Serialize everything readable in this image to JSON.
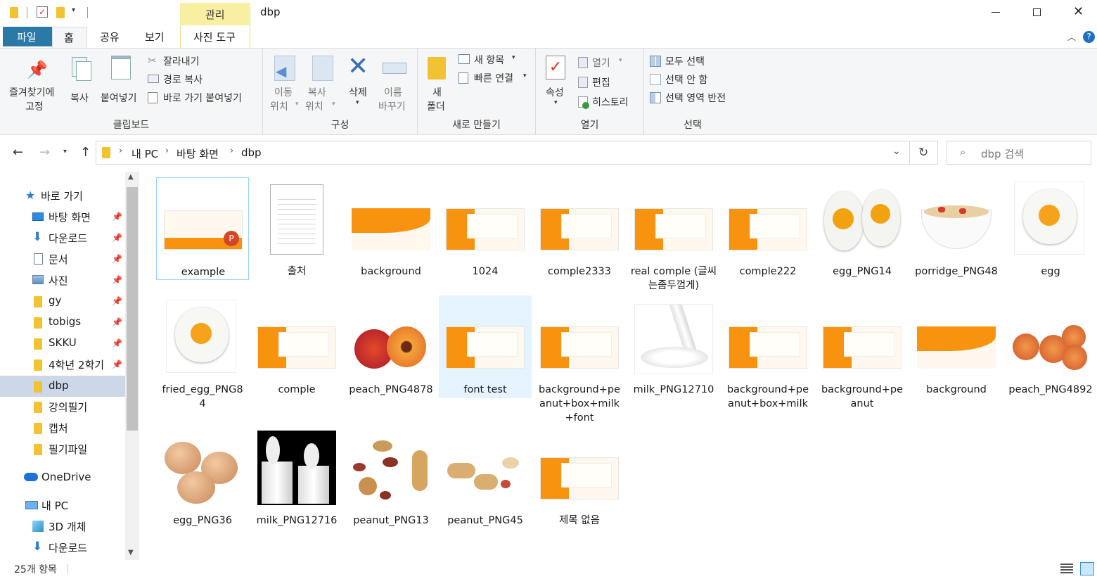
{
  "window": {
    "title": "dbp",
    "context_tab": "관리",
    "minimize_icon": "minimize-icon",
    "maximize_icon": "maximize-icon",
    "close_icon": "close-icon"
  },
  "ribbon_tabs": {
    "file": "파일",
    "home": "홈",
    "share": "공유",
    "view": "보기",
    "picture_tools": "사진 도구"
  },
  "clipboard": {
    "pin_line1": "즐겨찾기에",
    "pin_line2": "고정",
    "copy": "복사",
    "paste": "붙여넣기",
    "cut": "잘라내기",
    "copy_path": "경로 복사",
    "paste_shortcut": "바로 가기 붙여넣기",
    "group": "클립보드"
  },
  "organize": {
    "move_to_1": "이동",
    "move_to_2": "위치",
    "copy_to_1": "복사",
    "copy_to_2": "위치",
    "delete": "삭제",
    "rename_1": "이름",
    "rename_2": "바꾸기",
    "group": "구성"
  },
  "new": {
    "new_folder_1": "새",
    "new_folder_2": "폴더",
    "new_item": "새 항목",
    "easy_access": "빠른 연결",
    "group": "새로 만들기"
  },
  "open": {
    "properties": "속성",
    "open": "열기",
    "edit": "편집",
    "history": "히스토리",
    "group": "열기"
  },
  "select": {
    "select_all": "모두 선택",
    "select_none": "선택 안 함",
    "invert": "선택 영역 반전",
    "group": "선택"
  },
  "address": {
    "crumbs": [
      "내 PC",
      "바탕 화면",
      "dbp"
    ],
    "search_placeholder": "dbp 검색"
  },
  "nav": {
    "quick_access": "바로 가기",
    "items": [
      "바탕 화면",
      "다운로드",
      "문서",
      "사진",
      "gy",
      "tobigs",
      "SKKU",
      "4학년 2학기",
      "dbp",
      "강의필기",
      "캡처",
      "필기파일"
    ],
    "onedrive": "OneDrive",
    "this_pc": "내 PC",
    "pc_items": [
      "3D 개체",
      "다운로드"
    ]
  },
  "files": [
    {
      "name": "example",
      "kind": "pptx"
    },
    {
      "name": "출처",
      "kind": "doc"
    },
    {
      "name": "background",
      "kind": "bg"
    },
    {
      "name": "1024",
      "kind": "slide"
    },
    {
      "name": "comple2333",
      "kind": "slide"
    },
    {
      "name": "real comple (글씨는좀두껍게)",
      "kind": "slide"
    },
    {
      "name": "comple222",
      "kind": "slide"
    },
    {
      "name": "egg_PNG14",
      "kind": "egg2"
    },
    {
      "name": "porridge_PNG48",
      "kind": "porridge"
    },
    {
      "name": "egg",
      "kind": "egg"
    },
    {
      "name": "fried_egg_PNG84",
      "kind": "egg"
    },
    {
      "name": "comple",
      "kind": "slide"
    },
    {
      "name": "peach_PNG4878",
      "kind": "peach"
    },
    {
      "name": "font test",
      "kind": "slide"
    },
    {
      "name": "background+peanut+box+milk+font",
      "kind": "slide"
    },
    {
      "name": "milk_PNG12710",
      "kind": "milk"
    },
    {
      "name": "background+peanut+box+milk",
      "kind": "slide"
    },
    {
      "name": "background+peanut",
      "kind": "slide"
    },
    {
      "name": "background",
      "kind": "bg"
    },
    {
      "name": "peach_PNG4892",
      "kind": "peaches"
    },
    {
      "name": "egg_PNG36",
      "kind": "eggs"
    },
    {
      "name": "milk_PNG12716",
      "kind": "milkdark"
    },
    {
      "name": "peanut_PNG13",
      "kind": "peanut"
    },
    {
      "name": "peanut_PNG45",
      "kind": "peanut2"
    },
    {
      "name": "제목 없음",
      "kind": "slide"
    }
  ],
  "status": {
    "count": "25개 항목"
  },
  "colors": {
    "file_tab": "#2b79a6",
    "context_tab": "#f8f0a0",
    "selection": "#cce8ff",
    "accent_orange": "#f7930f"
  }
}
